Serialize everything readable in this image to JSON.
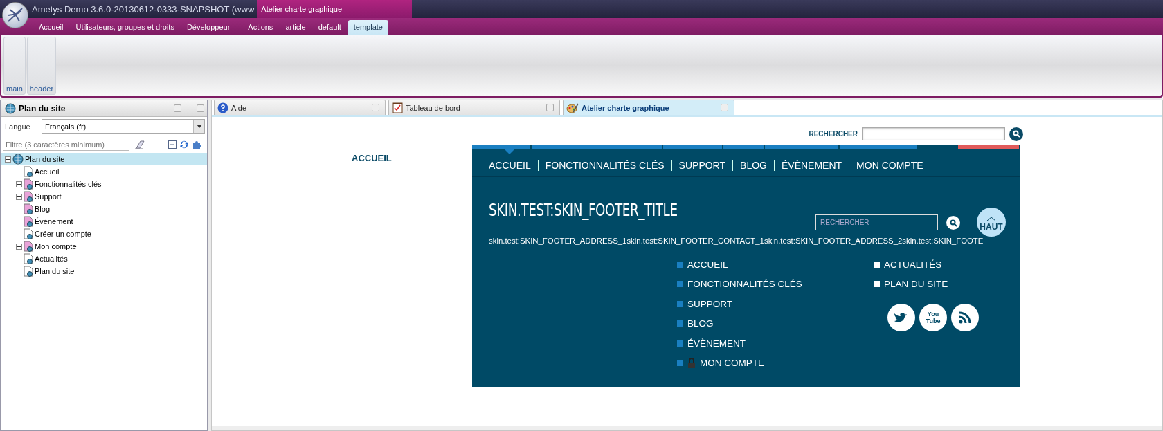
{
  "window": {
    "title": "Ametys Demo 3.6.0-20130612-0333-SNAPSHOT (www"
  },
  "context_group": {
    "title": "Atelier charte graphique"
  },
  "ribbon_tabs": [
    {
      "label": "Accueil",
      "selected": false
    },
    {
      "label": "Utilisateurs, groupes et droits",
      "selected": false
    },
    {
      "label": "Développeur",
      "selected": false
    },
    {
      "label": "Actions",
      "selected": false
    },
    {
      "label": "article",
      "selected": false
    },
    {
      "label": "default",
      "selected": false
    },
    {
      "label": "template",
      "selected": true
    }
  ],
  "ribbon_buttons": [
    "main",
    "header"
  ],
  "sitemap_panel": {
    "title": "Plan du site",
    "language_label": "Langue",
    "language": "Français (fr)",
    "filter_placeholder": "Filtre (3 caractères minimum)",
    "tree": [
      {
        "label": "Plan du site",
        "kind": "site",
        "selected": true,
        "expanded": true,
        "children": [
          {
            "label": "Accueil",
            "kind": "page",
            "selected": false
          },
          {
            "label": "Fonctionnalités clés",
            "kind": "restricted",
            "selected": false,
            "expanded": false,
            "has_children": true
          },
          {
            "label": "Support",
            "kind": "restricted",
            "selected": false,
            "expanded": false,
            "has_children": true
          },
          {
            "label": "Blog",
            "kind": "restricted",
            "selected": false
          },
          {
            "label": "Évènement",
            "kind": "restricted",
            "selected": false
          },
          {
            "label": "Créer un compte",
            "kind": "page",
            "selected": false
          },
          {
            "label": "Mon compte",
            "kind": "restricted",
            "selected": false,
            "expanded": false,
            "has_children": true
          },
          {
            "label": "Actualités",
            "kind": "page",
            "selected": false
          },
          {
            "label": "Plan du site",
            "kind": "page",
            "selected": false
          }
        ]
      }
    ]
  },
  "doc_tabs": [
    {
      "label": "Aide",
      "kind": "help",
      "selected": false
    },
    {
      "label": "Tableau de bord",
      "kind": "dashboard",
      "selected": false
    },
    {
      "label": "Atelier charte graphique",
      "kind": "palette",
      "selected": true
    }
  ],
  "preview": {
    "search_label": "RECHERCHER",
    "side_title": "ACCUEIL",
    "nav": [
      {
        "label": "ACCUEIL",
        "selected": true
      },
      {
        "label": "FONCTIONNALITÉS CLÉS",
        "selected": false
      },
      {
        "label": "SUPPORT",
        "selected": false
      },
      {
        "label": "BLOG",
        "selected": false
      },
      {
        "label": "ÉVÈNEMENT",
        "selected": false
      },
      {
        "label": "MON COMPTE",
        "selected": false
      }
    ],
    "footer_title": "SKIN.TEST:SKIN_FOOTER_TITLE",
    "footer_search_placeholder": "RECHERCHER",
    "top_button": "HAUT",
    "footer_address": "skin.test:SKIN_FOOTER_ADDRESS_1skin.test:SKIN_FOOTER_CONTACT_1skin.test:SKIN_FOOTER_ADDRESS_2skin.test:SKIN_FOOTE",
    "footer_links": [
      {
        "label": "ACCUEIL",
        "locked": false
      },
      {
        "label": "FONCTIONNALITÉS CLÉS",
        "locked": false
      },
      {
        "label": "SUPPORT",
        "locked": false
      },
      {
        "label": "BLOG",
        "locked": false
      },
      {
        "label": "ÉVÈNEMENT",
        "locked": false
      },
      {
        "label": "MON COMPTE",
        "locked": true
      }
    ],
    "footer_links_2": [
      "ACTUALITÉS",
      "PLAN DU SITE"
    ],
    "social": [
      {
        "kind": "bird"
      },
      {
        "kind": "video",
        "lines": [
          "You",
          "Tube"
        ]
      },
      {
        "kind": "feed"
      }
    ]
  }
}
